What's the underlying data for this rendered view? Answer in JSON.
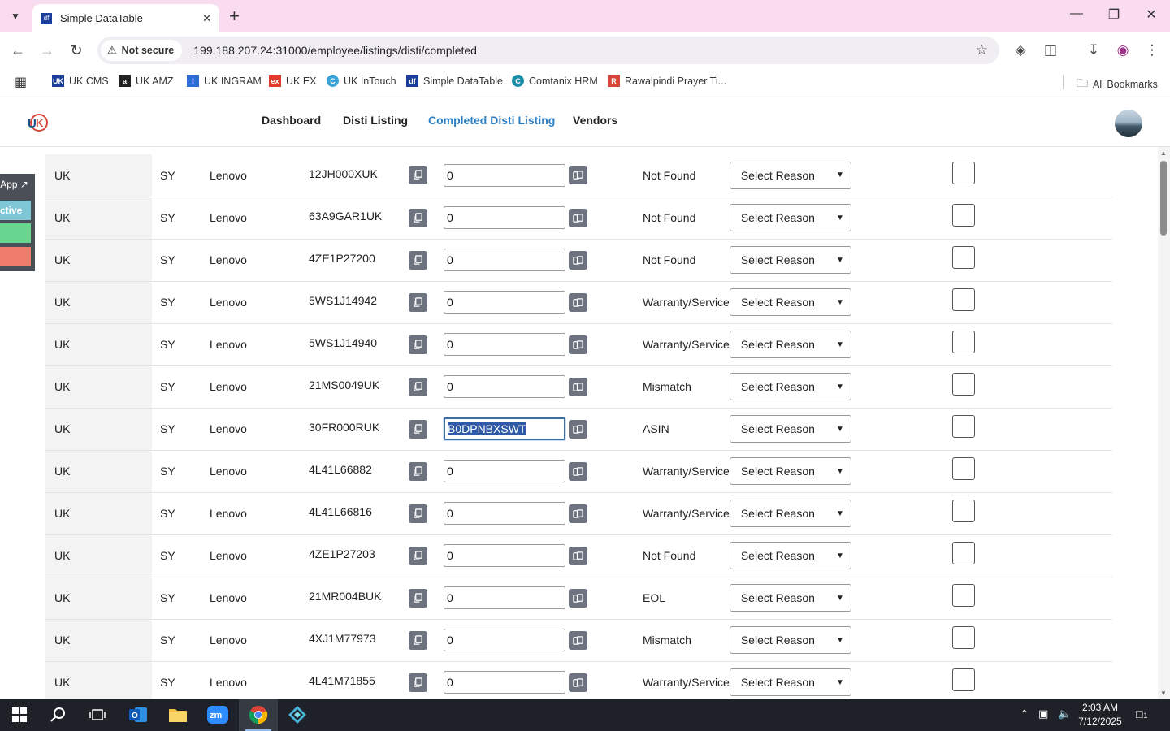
{
  "browser": {
    "tab_title": "Simple DataTable",
    "tab_favicon": "df",
    "security_label": "Not secure",
    "url": "199.188.207.24:31000/employee/listings/disti/completed",
    "bookmarks": [
      {
        "label": "UK CMS",
        "icon": "UK",
        "color": "#1a3e9a"
      },
      {
        "label": "UK AMZ",
        "icon": "a",
        "color": "#222222"
      },
      {
        "label": "UK INGRAM",
        "icon": "I",
        "color": "#2b6cd6"
      },
      {
        "label": "UK EX",
        "icon": "ex",
        "color": "#e23b2e"
      },
      {
        "label": "UK InTouch",
        "icon": "C",
        "color": "#3aa3d8"
      },
      {
        "label": "Simple DataTable",
        "icon": "df",
        "color": "#1a3e9a"
      },
      {
        "label": "Comtanix HRM",
        "icon": "C",
        "color": "#1a8ea8"
      },
      {
        "label": "Rawalpindi Prayer Ti...",
        "icon": "R",
        "color": "#d9443a"
      }
    ],
    "all_bookmarks": "All Bookmarks"
  },
  "nav": {
    "links": [
      "Dashboard",
      "Disti Listing",
      "Completed Disti Listing",
      "Vendors"
    ],
    "active_index": 2
  },
  "side_panel": {
    "app_label": "App ↗",
    "active_label": "ctive"
  },
  "select_placeholder": "Select Reason",
  "rows": [
    {
      "country": "UK",
      "code": "SY",
      "vendor": "Lenovo",
      "sku": "12JH000XUK",
      "value": "0",
      "status": "Not Found"
    },
    {
      "country": "UK",
      "code": "SY",
      "vendor": "Lenovo",
      "sku": "63A9GAR1UK",
      "value": "0",
      "status": "Not Found"
    },
    {
      "country": "UK",
      "code": "SY",
      "vendor": "Lenovo",
      "sku": "4ZE1P27200",
      "value": "0",
      "status": "Not Found"
    },
    {
      "country": "UK",
      "code": "SY",
      "vendor": "Lenovo",
      "sku": "5WS1J14942",
      "value": "0",
      "status": "Warranty/Service"
    },
    {
      "country": "UK",
      "code": "SY",
      "vendor": "Lenovo",
      "sku": "5WS1J14940",
      "value": "0",
      "status": "Warranty/Service"
    },
    {
      "country": "UK",
      "code": "SY",
      "vendor": "Lenovo",
      "sku": "21MS0049UK",
      "value": "0",
      "status": "Mismatch"
    },
    {
      "country": "UK",
      "code": "SY",
      "vendor": "Lenovo",
      "sku": "30FR000RUK",
      "value": "B0DPNBXSWT",
      "status": "ASIN",
      "focused": true
    },
    {
      "country": "UK",
      "code": "SY",
      "vendor": "Lenovo",
      "sku": "4L41L66882",
      "value": "0",
      "status": "Warranty/Service"
    },
    {
      "country": "UK",
      "code": "SY",
      "vendor": "Lenovo",
      "sku": "4L41L66816",
      "value": "0",
      "status": "Warranty/Service"
    },
    {
      "country": "UK",
      "code": "SY",
      "vendor": "Lenovo",
      "sku": "4ZE1P27203",
      "value": "0",
      "status": "Not Found"
    },
    {
      "country": "UK",
      "code": "SY",
      "vendor": "Lenovo",
      "sku": "21MR004BUK",
      "value": "0",
      "status": "EOL"
    },
    {
      "country": "UK",
      "code": "SY",
      "vendor": "Lenovo",
      "sku": "4XJ1M77973",
      "value": "0",
      "status": "Mismatch"
    },
    {
      "country": "UK",
      "code": "SY",
      "vendor": "Lenovo",
      "sku": "4L41M71855",
      "value": "0",
      "status": "Warranty/Service"
    }
  ],
  "taskbar": {
    "time": "2:03 AM",
    "date": "7/12/2025",
    "notifications": "1"
  },
  "colors": {
    "accent": "#2c7fc4",
    "tabstrip": "#f9dcef",
    "icon_button": "#6d7480"
  }
}
